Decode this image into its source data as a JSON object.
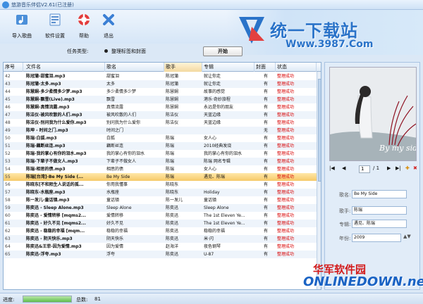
{
  "window": {
    "title": "悠游音乐伴侣V2.61(已注册)"
  },
  "toolbar": {
    "import_label": "导入歌曲",
    "settings_label": "软件设置",
    "help_label": "帮助",
    "exit_label": "退出"
  },
  "watermark": {
    "top_cn": "统一下载站",
    "top_url": "Www.3987.Com",
    "bottom_cn": "华军软件园",
    "bottom_url": "ONLINEDOWN.net"
  },
  "task": {
    "label": "任务类型:",
    "option": "整理标签和封面",
    "start_label": "开始"
  },
  "table": {
    "headers": [
      "序号",
      "文件名",
      "歌名",
      "歌手",
      "专辑",
      "封面",
      "状态"
    ],
    "rows": [
      {
        "no": "42",
        "file": "陈冠蒲-甜蜜泪.mp3",
        "song": "甜蜜泪",
        "artist": "陈冠蒲",
        "album": "就让你走",
        "cover": "有",
        "status": "整理成功"
      },
      {
        "no": "43",
        "file": "陈冠蒲-太多.mp3",
        "song": "太多",
        "artist": "陈冠蒲",
        "album": "就让你走",
        "cover": "有",
        "status": "整理成功"
      },
      {
        "no": "44",
        "file": "陈慧娴-多少柔情多少梦.mp3",
        "song": "多少柔情多少梦",
        "artist": "陈慧娴",
        "album": "故事的感觉",
        "cover": "有",
        "status": "整理成功"
      },
      {
        "no": "45",
        "file": "陈慧娴-飘雪(Live).mp3",
        "song": "飘雪",
        "artist": "陈慧娴",
        "album": "港乐·奇妙旅程",
        "cover": "有",
        "status": "整理成功"
      },
      {
        "no": "46",
        "file": "陈慧娴-真情流露.mp3",
        "song": "真情流露",
        "artist": "陈慧娴",
        "album": "永远是你的朋友",
        "cover": "有",
        "status": "整理成功"
      },
      {
        "no": "47",
        "file": "陈洁仪-被风吹散的人们.mp3",
        "song": "被风吹散的人们",
        "artist": "陈洁仪",
        "album": "天蓝边缘",
        "cover": "有",
        "status": "整理成功"
      },
      {
        "no": "48",
        "file": "陈洁仪-别问我为什么爱你.mp3",
        "song": "别问我为什么爱你",
        "artist": "陈洁仪",
        "album": "天蓝边缘",
        "cover": "有",
        "status": "整理成功"
      },
      {
        "no": "49",
        "file": "陈坤 - 时间之门.mp3",
        "song": "时间之门",
        "artist": "",
        "album": "",
        "cover": "无",
        "status": "整理成功"
      },
      {
        "no": "50",
        "file": "陈瑞-白狐.mp3",
        "song": "白狐",
        "artist": "陈瑞",
        "album": "女人心",
        "cover": "有",
        "status": "整理成功"
      },
      {
        "no": "51",
        "file": "陈瑞-藕断丝连.mp3",
        "song": "藕断丝连",
        "artist": "陈瑞",
        "album": "2010经典发烧",
        "cover": "有",
        "status": "整理成功"
      },
      {
        "no": "52",
        "file": "陈瑞-我的掌心有你的泪水.mp3",
        "song": "我的掌心有你的泪水",
        "artist": "陈瑞",
        "album": "我的掌心有你的泪水",
        "cover": "有",
        "status": "整理成功"
      },
      {
        "no": "53",
        "file": "陈瑞-下辈子不做女人.mp3",
        "song": "下辈子不做女人",
        "artist": "陈瑞",
        "album": "陈瑞 网名专辑",
        "cover": "有",
        "status": "整理成功"
      },
      {
        "no": "54",
        "file": "陈瑞-相思的债.mp3",
        "song": "相思的债",
        "artist": "陈瑞",
        "album": "女人心",
        "cover": "有",
        "status": "整理成功"
      },
      {
        "no": "55",
        "file": "陈瑞[台湾]-Be My Side (...",
        "song": "Be My Side",
        "artist": "陈瑞",
        "album": "遇见、陈瑞",
        "cover": "有",
        "status": "整理成功"
      },
      {
        "no": "56",
        "file": "陈晓东[不和陌生人说话的孤...",
        "song": "你用我懂事",
        "artist": "陈晓东",
        "album": "",
        "cover": "有",
        "status": "整理成功"
      },
      {
        "no": "57",
        "file": "陈晓东-水瓶座.mp3",
        "song": "水瓶座",
        "artist": "陈晓东",
        "album": "Holiday",
        "cover": "有",
        "status": "整理成功"
      },
      {
        "no": "58",
        "file": "陈一发儿-童话镇.mp3",
        "song": "童话镇",
        "artist": "陈一发儿",
        "album": "童话镇",
        "cover": "有",
        "status": "整理成功"
      },
      {
        "no": "59",
        "file": "陈奕迅 - Sleep Alone.mp3",
        "song": "Sleep Alone",
        "artist": "陈奕迅",
        "album": "Sleep Alone",
        "cover": "有",
        "status": "整理成功"
      },
      {
        "no": "60",
        "file": "陈奕迅 - 爱情转移 [mqms2...",
        "song": "爱情转移",
        "artist": "陈奕迅",
        "album": "The 1st Eleven Ye...",
        "cover": "有",
        "status": "整理成功"
      },
      {
        "no": "61",
        "file": "陈奕迅 - 好久不见 [mqms2...",
        "song": "好久不见",
        "artist": "陈奕迅",
        "album": "The 1st Eleven Ye...",
        "cover": "有",
        "status": "整理成功"
      },
      {
        "no": "62",
        "file": "陈奕迅 - 稳稳的幸福 [mqm...",
        "song": "稳稳的幸福",
        "artist": "陈奕迅",
        "album": "稳稳的幸福",
        "cover": "有",
        "status": "整理成功"
      },
      {
        "no": "63",
        "file": "陈奕迅 - 阴天快乐.mp3",
        "song": "阴天快乐",
        "artist": "陈奕迅",
        "album": "米·闪",
        "cover": "有",
        "status": "整理成功"
      },
      {
        "no": "64",
        "file": "陈奕迅&王菲-因为爱情.mp3",
        "song": "因为爱情",
        "artist": "赵海洋",
        "album": "夜色钢琴",
        "cover": "有",
        "status": "整理成功"
      },
      {
        "no": "65",
        "file": "陈奕迅-浮夸.mp3",
        "song": "浮夸",
        "artist": "陈奕迅",
        "album": "U-87",
        "cover": "有",
        "status": "整理成功"
      }
    ]
  },
  "selected_row": 13,
  "cover_art": {
    "text": "By my side"
  },
  "cover_nav": {
    "page": "1",
    "total": "/ 1"
  },
  "details": {
    "song_label": "歌名:",
    "song": "Be My Side",
    "artist_label": "歌手:",
    "artist": "陈瑞",
    "album_label": "专辑:",
    "album": "遇见、陈瑞",
    "year_label": "年份:",
    "year": "2009"
  },
  "status": {
    "progress_label": "进度:",
    "progress": 1.0,
    "total_label": "总数:",
    "total": "81"
  },
  "colors": {
    "accent": "#2a73c9",
    "status_ok": "#d80000",
    "selected_row": "#f6c968"
  }
}
